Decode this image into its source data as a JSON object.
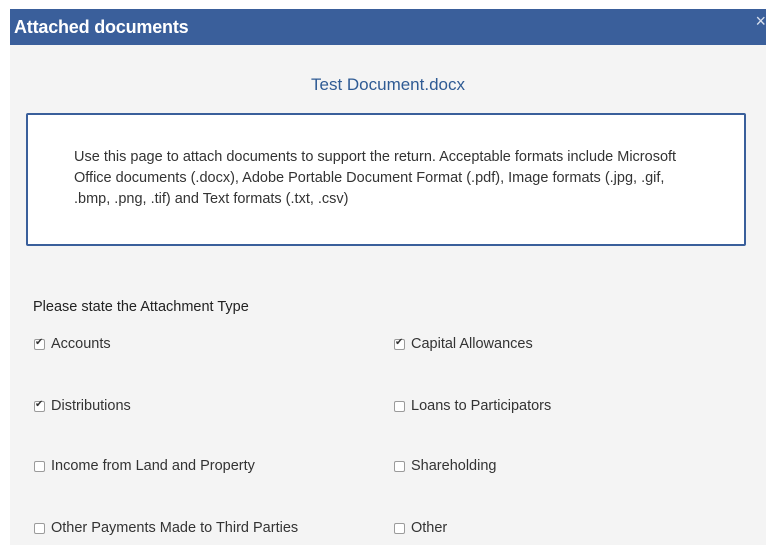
{
  "dialog": {
    "title": "Attached documents",
    "close_glyph": "×",
    "document_name": "Test Document.docx",
    "info_text": "Use this page to attach documents to support the return. Acceptable formats include Microsoft Office documents (.docx), Adobe Portable Document Format (.pdf), Image formats (.jpg, .gif, .bmp, .png, .tif) and Text formats (.txt, .csv)",
    "attachment_heading": "Please state the Attachment Type",
    "options": [
      {
        "label": "Accounts",
        "checked": true
      },
      {
        "label": "Capital Allowances",
        "checked": true
      },
      {
        "label": "Distributions",
        "checked": true
      },
      {
        "label": "Loans to Participators",
        "checked": false
      },
      {
        "label": "Income from Land and Property",
        "checked": false
      },
      {
        "label": "Shareholding",
        "checked": false
      },
      {
        "label": "Other Payments Made to Third Parties",
        "checked": false
      },
      {
        "label": "Other",
        "checked": false
      }
    ]
  },
  "colors": {
    "titlebar": "#3a5f9b",
    "document_name": "#2f5b94",
    "info_border": "#3a5f9b",
    "dialog_bg": "#f4f4f4"
  }
}
